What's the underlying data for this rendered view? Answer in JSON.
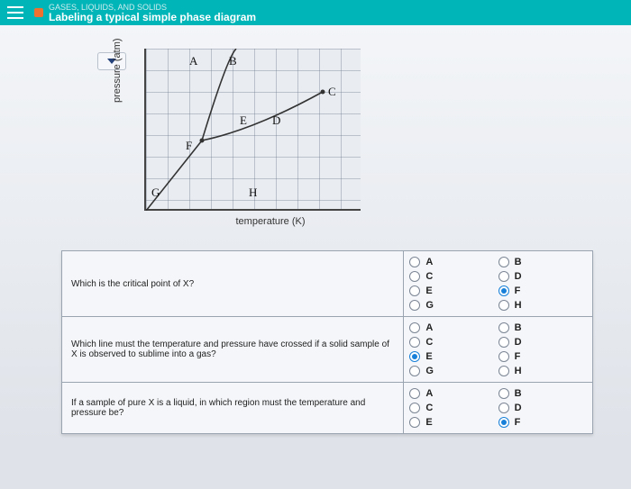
{
  "header": {
    "subject": "GASES, LIQUIDS, AND SOLIDS",
    "title": "Labeling a typical simple phase diagram"
  },
  "axes": {
    "y": "pressure (atm)",
    "x": "temperature  (K)"
  },
  "labels": {
    "A": "A",
    "B": "B",
    "C": "C",
    "D": "D",
    "E": "E",
    "F": "F",
    "G": "G",
    "H": "H"
  },
  "questions": [
    {
      "text": "Which is the critical point of X?",
      "options": [
        "A",
        "B",
        "C",
        "D",
        "E",
        "F",
        "G",
        "H"
      ],
      "selected": "F"
    },
    {
      "text": "Which line must the temperature and pressure have crossed if a solid sample of X is observed to sublime into a gas?",
      "options": [
        "A",
        "B",
        "C",
        "D",
        "E",
        "F",
        "G",
        "H"
      ],
      "selected": "E"
    },
    {
      "text": "If a sample of pure X is a liquid, in which region must the temperature and pressure be?",
      "options": [
        "A",
        "B",
        "C",
        "D",
        "E",
        "F"
      ],
      "selected": "F"
    }
  ]
}
